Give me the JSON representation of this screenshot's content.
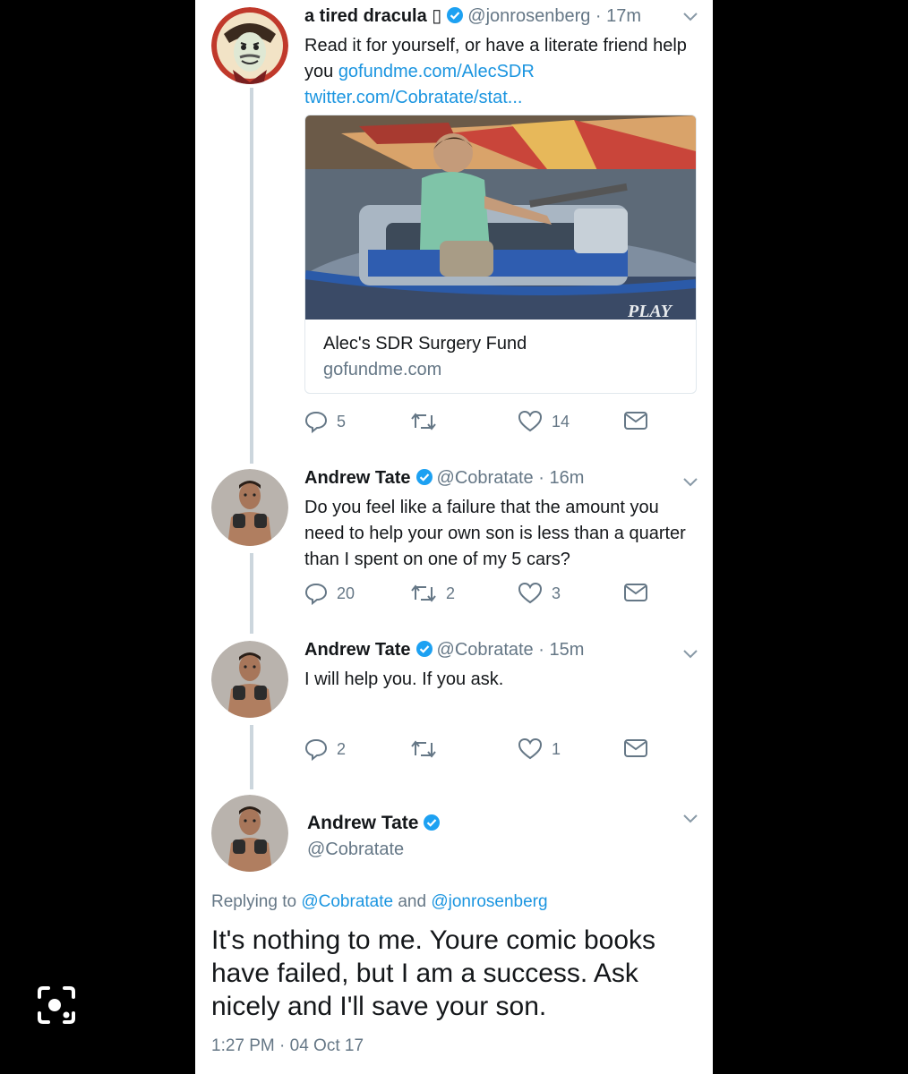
{
  "tweet1": {
    "name": "a tired dracula ",
    "name_glyph": "▯",
    "handle": "@jonrosenberg",
    "time": "17m",
    "text_plain": "Read it for yourself, or have a literate friend help you ",
    "link1": "gofundme.com/AlecSDR",
    "link2": "twitter.com/Cobratate/stat...",
    "card": {
      "title": "Alec's SDR Surgery Fund",
      "domain": "gofundme.com",
      "image_text": "PLAY"
    },
    "replies": "5",
    "retweets": "",
    "likes": "14"
  },
  "tweet2": {
    "name": "Andrew Tate",
    "handle": "@Cobratate",
    "time": "16m",
    "text": "Do you feel like a failure that the amount you need to help your own son is less than a quarter than I spent on one of my 5 cars?",
    "replies": "20",
    "retweets": "2",
    "likes": "3"
  },
  "tweet3": {
    "name": "Andrew Tate",
    "handle": "@Cobratate",
    "time": "15m",
    "text": "I will help you. If you ask.",
    "replies": "2",
    "retweets": "",
    "likes": "1"
  },
  "main": {
    "name": "Andrew Tate",
    "handle": "@Cobratate",
    "replying_prefix": "Replying to ",
    "replying_user1": "@Cobratate",
    "replying_and": " and ",
    "replying_user2": "@jonrosenberg",
    "text": "It's nothing to me. Youre comic books have failed, but I am a success. Ask nicely and I'll save your son.",
    "timestamp": "1:27 PM · 04 Oct 17"
  },
  "separator": " · ",
  "colors": {
    "link": "#1b95e0",
    "verified": "#1da1f2",
    "muted": "#657786",
    "thread_line": "#ccd6dd",
    "background": "#000000"
  },
  "icons": [
    "reply-icon",
    "retweet-icon",
    "like-icon",
    "message-icon",
    "verified-icon",
    "chevron-down-icon",
    "lens-icon"
  ]
}
